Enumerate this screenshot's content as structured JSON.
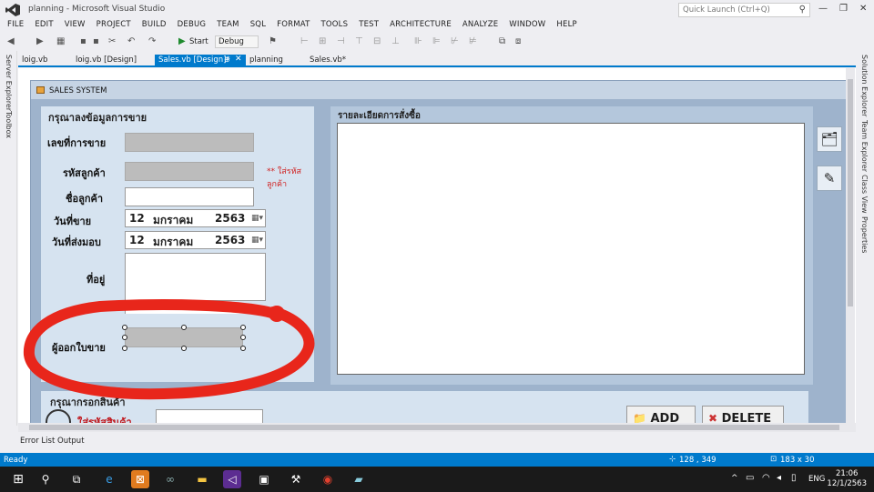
{
  "window": {
    "title": "planning - Microsoft Visual Studio",
    "quick_launch_placeholder": "Quick Launch (Ctrl+Q)"
  },
  "menu": [
    "FILE",
    "EDIT",
    "VIEW",
    "PROJECT",
    "BUILD",
    "DEBUG",
    "TEAM",
    "SQL",
    "FORMAT",
    "TOOLS",
    "TEST",
    "ARCHITECTURE",
    "ANALYZE",
    "WINDOW",
    "HELP"
  ],
  "toolbar": {
    "start_label": "Start",
    "config_value": "Debug"
  },
  "left_strip": {
    "server_explorer": "Server Explorer",
    "toolbox": "Toolbox"
  },
  "right_strip": {
    "solution_explorer": "Solution Explorer",
    "team_explorer": "Team Explorer",
    "class_view": "Class View",
    "properties": "Properties"
  },
  "tabs": [
    {
      "label": "loig.vb"
    },
    {
      "label": "loig.vb [Design]"
    },
    {
      "label": "Sales.vb [Design]*",
      "active": true
    },
    {
      "label": "planning"
    },
    {
      "label": "Sales.vb*"
    }
  ],
  "form": {
    "title": "SALES SYSTEM",
    "group_input": {
      "title": "กรุณาลงข้อมูลการขาย",
      "sale_no_label": "เลขที่การขาย",
      "customer_code_label": "รหัสลูกค้า",
      "customer_code_hint": "** ใส่รหัสลูกค้า",
      "customer_name_label": "ชื่อลูกค้า",
      "sale_date_label": "วันที่ขาย",
      "sale_date": {
        "day": "12",
        "month": "มกราคม",
        "year": "2563"
      },
      "delivery_date_label": "วันที่ส่งมอบ",
      "delivery_date": {
        "day": "12",
        "month": "มกราคม",
        "year": "2563"
      },
      "address_label": "ที่อยู่",
      "issuer_label": "ผู้ออกใบขาย"
    },
    "group_order": {
      "title": "รายละเอียดการสั่งซื้อ"
    },
    "group_product": {
      "title": "กรุณากรอกสินค้า",
      "product_code_label": "ใส่รหัสสินค้า"
    },
    "add_label": "ADD",
    "delete_label": "DELETE"
  },
  "bottom_tabs": [
    "Error List",
    "Output"
  ],
  "status": {
    "text": "Ready",
    "position": "128 , 349",
    "size": "183 x 30"
  },
  "taskbar": {
    "lang": "ENG",
    "time": "21:06",
    "date": "12/1/2563"
  },
  "colors": {
    "accent": "#007acc",
    "hint_red": "#d0201f",
    "annotation_red": "#e8261b"
  }
}
